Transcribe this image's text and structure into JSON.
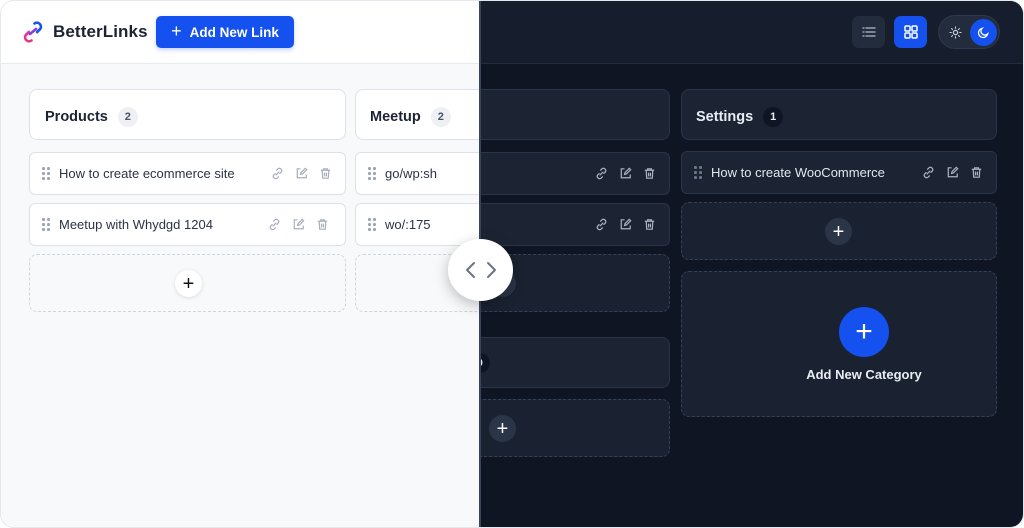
{
  "brand": {
    "name": "BetterLinks",
    "logo_icon": "betterlinks-logo-icon",
    "accent": "#1551ee"
  },
  "header": {
    "add_link_label": "Add New Link"
  },
  "light_columns": [
    {
      "title": "Products",
      "count": "2",
      "links": [
        "How to create ecommerce site",
        "Meetup with Whydgd 1204"
      ]
    },
    {
      "title": "Meetup",
      "count": "2",
      "links": [
        "go/wp:sh",
        "wo/:175"
      ]
    }
  ],
  "dark_columns": [
    {
      "title": "Settings",
      "count": "1",
      "links": [
        "How to create WooCommerce"
      ]
    }
  ],
  "dark_partial": {
    "count": "0"
  },
  "add_category_label": "Add New Category",
  "icons": {
    "link": "link-icon",
    "edit": "edit-icon",
    "delete": "trash-icon",
    "drag": "drag-handle-icon",
    "list_view": "list-view-icon",
    "grid_view": "grid-view-icon",
    "sun": "sun-icon",
    "moon": "moon-icon",
    "compare": "compare-arrows-icon"
  },
  "colors": {
    "light_bg": "#f7f9fb",
    "dark_bg": "#0f1522",
    "dark_card": "#1c2434"
  }
}
